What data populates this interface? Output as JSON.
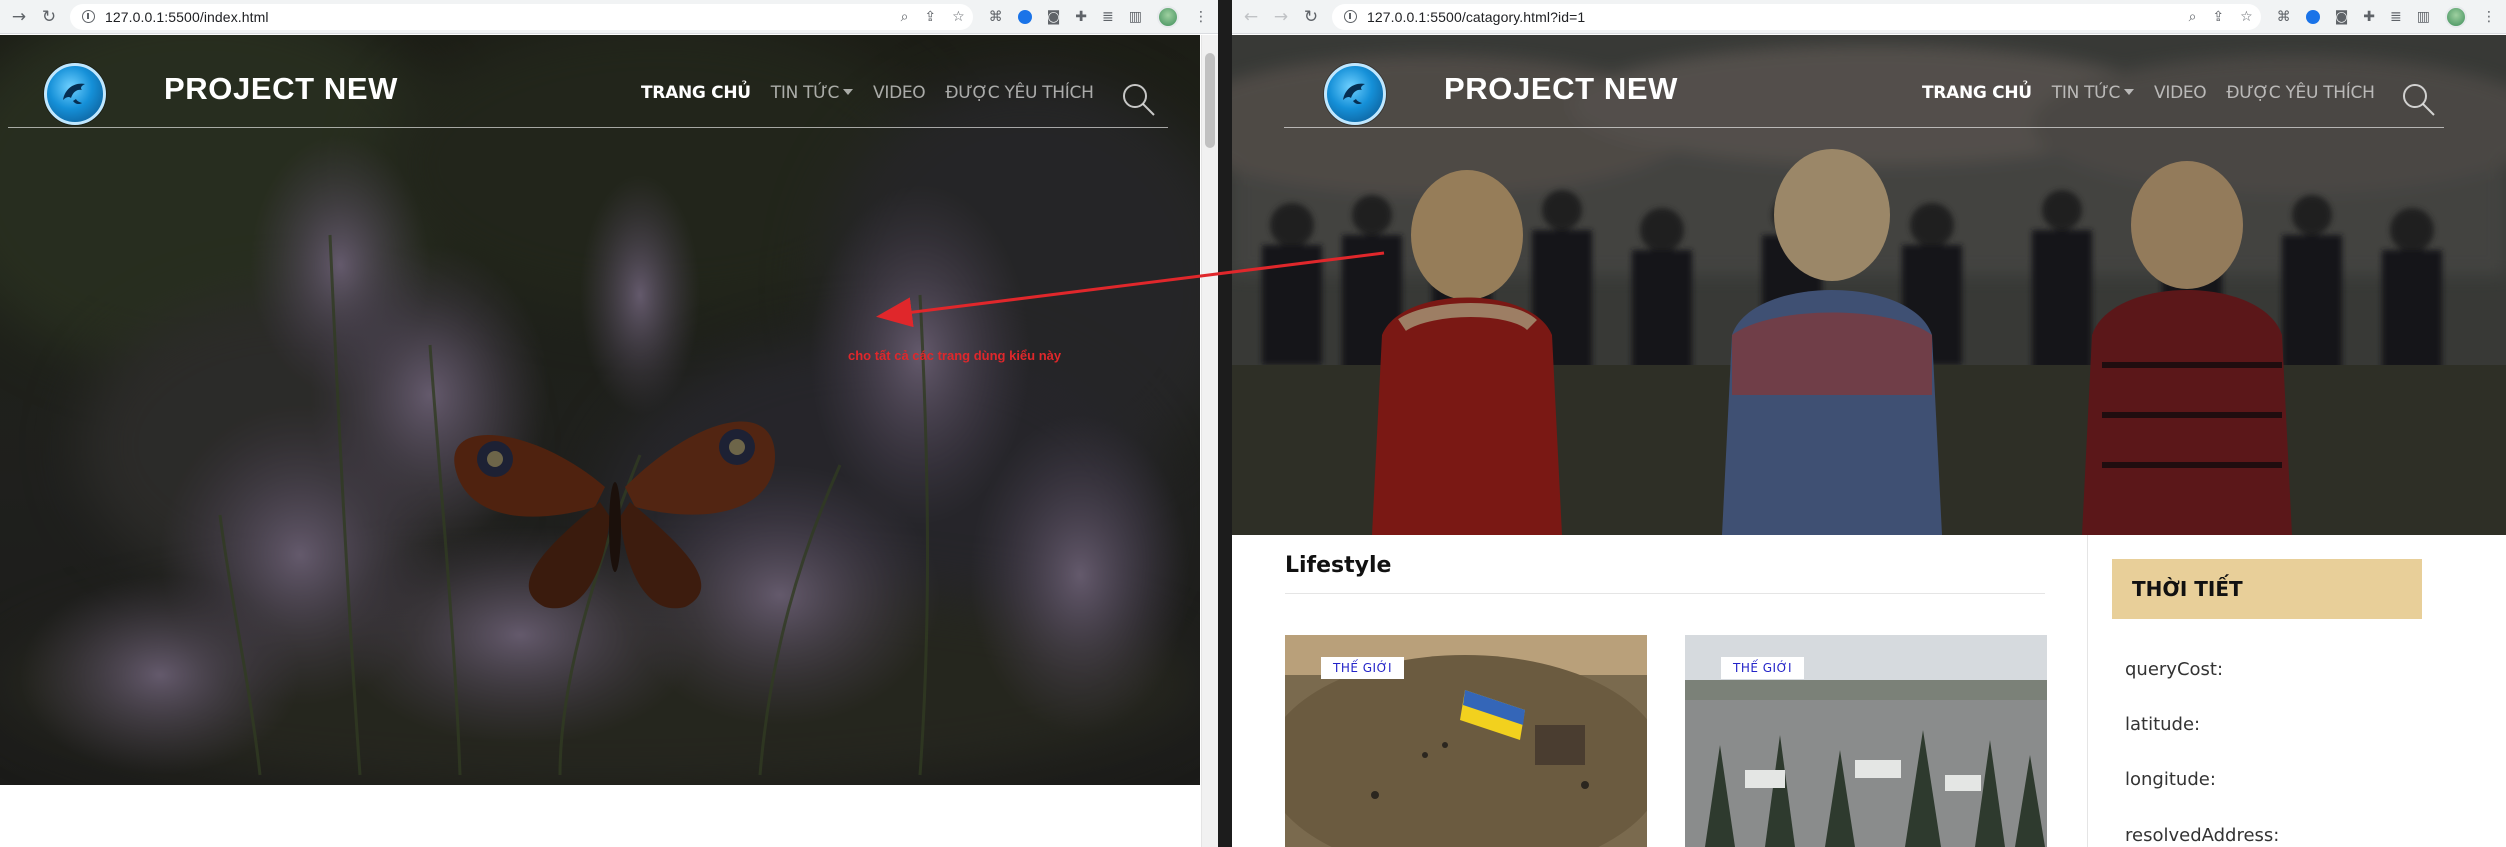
{
  "left_browser": {
    "url_host": "127.0.0.1",
    "url_rest": ":5500/index.html"
  },
  "right_browser": {
    "url_host": "127.0.0.1",
    "url_rest": ":5500/catagory.html?id=1"
  },
  "site": {
    "brand": "PROJECT NEW",
    "menu": {
      "home": "TRANG CHỦ",
      "news": "TIN TỨC",
      "video": "VIDEO",
      "favorites": "ĐƯỢC YÊU THÍCH"
    }
  },
  "annotation": {
    "text": "cho tất cả các trang dùng kiểu này",
    "color": "#e0272b"
  },
  "category_page": {
    "section_title": "Lifestyle",
    "cards": [
      {
        "tag": "THẾ GIỚI"
      },
      {
        "tag": "THẾ GIỚI"
      }
    ],
    "weather": {
      "title": "THỜI TIẾT",
      "fields": [
        "queryCost:",
        "latitude:",
        "longitude:",
        "resolvedAddress:"
      ]
    }
  },
  "colors": {
    "weather_header_bg": "#e8cf99",
    "tag_text": "#2323c8"
  }
}
